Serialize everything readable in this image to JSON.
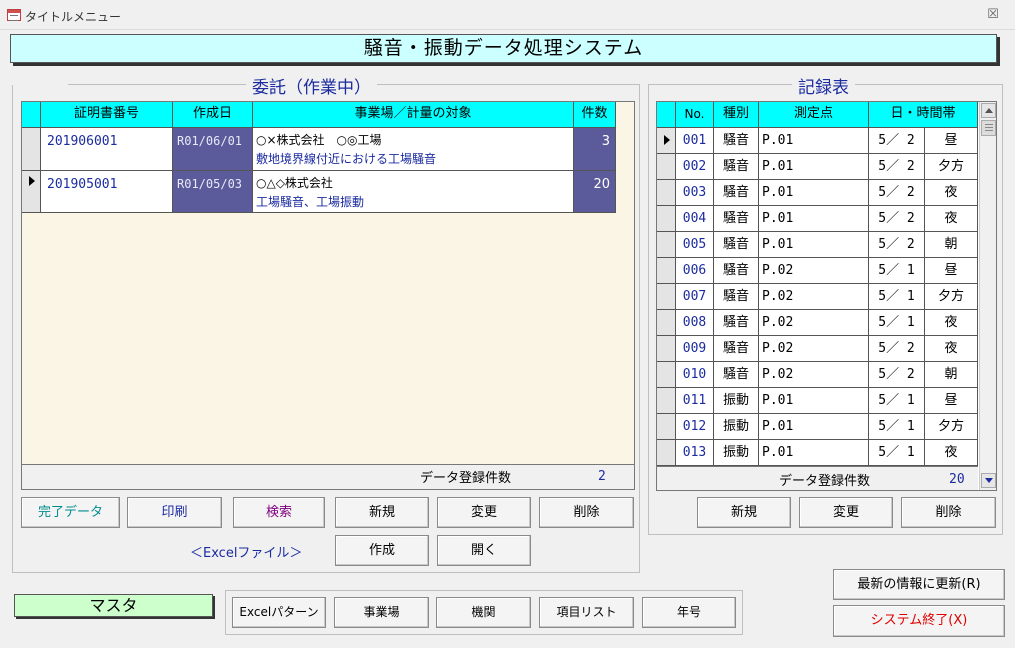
{
  "window": {
    "title": "タイトルメニュー",
    "close_glyph": "☒"
  },
  "header": {
    "title": "騒音・振動データ処理システム"
  },
  "commission": {
    "frame_title": "委託（作業中）",
    "columns": [
      "証明書番号",
      "作成日",
      "事業場／計量の対象",
      "件数"
    ],
    "rows": [
      {
        "cert_no": "201906001",
        "date": "R01/06/01",
        "line1": "○×株式会社　○◎工場",
        "line2": "敷地境界線付近における工場騒音",
        "count": "3",
        "current": false
      },
      {
        "cert_no": "201905001",
        "date": "R01/05/03",
        "line1": "○△◇株式会社",
        "line2": "工場騒音、工場振動",
        "count": "20",
        "current": true
      }
    ],
    "footer_label": "データ登録件数",
    "footer_count": "2",
    "buttons": {
      "complete": "完了データ",
      "print": "印刷",
      "search": "検索",
      "new": "新規",
      "change": "変更",
      "delete": "削除"
    },
    "excel_label": "＜Excelファイル＞",
    "excel_buttons": {
      "create": "作成",
      "open": "開く"
    }
  },
  "records": {
    "frame_title": "記録表",
    "columns": [
      "No.",
      "種別",
      "測定点",
      "日・時間帯"
    ],
    "rows": [
      {
        "no": "001",
        "type": "騒音",
        "point": "P.01",
        "day": "5／ 2",
        "slot": "昼",
        "current": true
      },
      {
        "no": "002",
        "type": "騒音",
        "point": "P.01",
        "day": "5／ 2",
        "slot": "夕方",
        "current": false
      },
      {
        "no": "003",
        "type": "騒音",
        "point": "P.01",
        "day": "5／ 2",
        "slot": "夜",
        "current": false
      },
      {
        "no": "004",
        "type": "騒音",
        "point": "P.01",
        "day": "5／ 2",
        "slot": "夜",
        "current": false
      },
      {
        "no": "005",
        "type": "騒音",
        "point": "P.01",
        "day": "5／ 2",
        "slot": "朝",
        "current": false
      },
      {
        "no": "006",
        "type": "騒音",
        "point": "P.02",
        "day": "5／ 1",
        "slot": "昼",
        "current": false
      },
      {
        "no": "007",
        "type": "騒音",
        "point": "P.02",
        "day": "5／ 1",
        "slot": "夕方",
        "current": false
      },
      {
        "no": "008",
        "type": "騒音",
        "point": "P.02",
        "day": "5／ 1",
        "slot": "夜",
        "current": false
      },
      {
        "no": "009",
        "type": "騒音",
        "point": "P.02",
        "day": "5／ 2",
        "slot": "夜",
        "current": false
      },
      {
        "no": "010",
        "type": "騒音",
        "point": "P.02",
        "day": "5／ 2",
        "slot": "朝",
        "current": false
      },
      {
        "no": "011",
        "type": "振動",
        "point": "P.01",
        "day": "5／ 1",
        "slot": "昼",
        "current": false
      },
      {
        "no": "012",
        "type": "振動",
        "point": "P.01",
        "day": "5／ 1",
        "slot": "夕方",
        "current": false
      },
      {
        "no": "013",
        "type": "振動",
        "point": "P.01",
        "day": "5／ 1",
        "slot": "夜",
        "current": false
      }
    ],
    "footer_label": "データ登録件数",
    "footer_count": "20",
    "buttons": {
      "new": "新規",
      "change": "変更",
      "delete": "削除"
    }
  },
  "master": {
    "label": "マスタ",
    "buttons": {
      "excel_pattern": "Excelパターン",
      "business": "事業場",
      "agency": "機関",
      "item_list": "項目リスト",
      "era": "年号"
    }
  },
  "actions": {
    "refresh": "最新の情報に更新(R)",
    "exit": "システム終了(X)"
  },
  "colors": {
    "header_cyan": "#00ffff",
    "banner": "#ccffff",
    "text_blue": "#1b2ba0",
    "date_cell": "#5b5b9b",
    "exit_red": "#e00000",
    "search_purple": "#800080",
    "teal": "#008b8b",
    "master_green": "#ccffcc",
    "list_bg": "#fbf5e6"
  }
}
